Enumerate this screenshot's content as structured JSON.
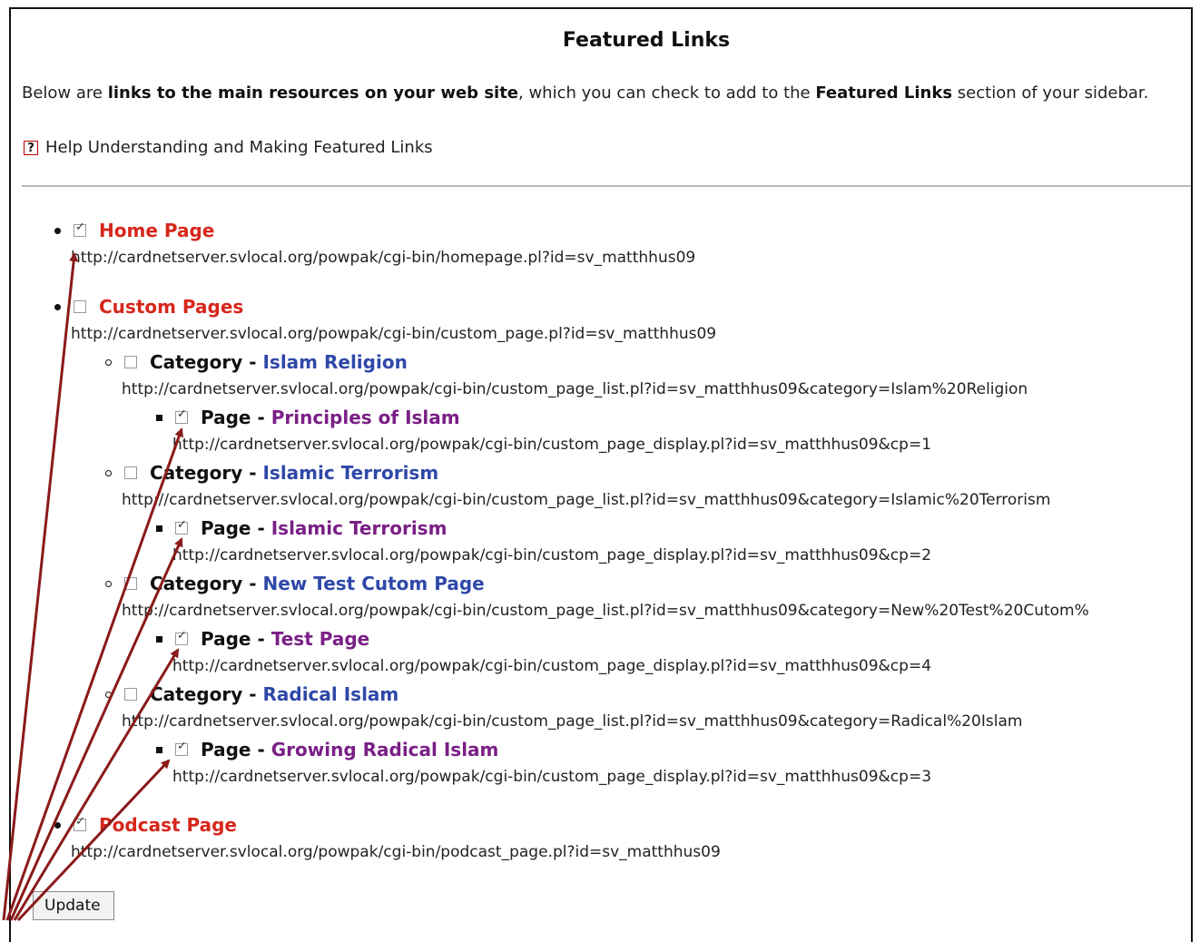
{
  "title": "Featured Links",
  "intro": {
    "part1": "Below are ",
    "bold1": "links to the main resources on your web site",
    "part2": ", which you can check to add to the ",
    "bold2": "Featured Links",
    "part3": " section of your sidebar."
  },
  "help": {
    "icon": "help-icon",
    "label": "Help Understanding and Making Featured Links"
  },
  "items": {
    "home": {
      "label": "Home Page",
      "url": "http://cardnetserver.svlocal.org/powpak/cgi-bin/homepage.pl?id=sv_matthhus09",
      "checked": true
    },
    "custom": {
      "label": "Custom Pages",
      "url": "http://cardnetserver.svlocal.org/powpak/cgi-bin/custom_page.pl?id=sv_matthhus09",
      "checked": false
    },
    "cat1": {
      "prefix": "Category - ",
      "name": "Islam Religion",
      "url": "http://cardnetserver.svlocal.org/powpak/cgi-bin/custom_page_list.pl?id=sv_matthhus09&category=Islam%20Religion",
      "checked": false
    },
    "page1": {
      "prefix": "Page - ",
      "name": "Principles of Islam",
      "url": "http://cardnetserver.svlocal.org/powpak/cgi-bin/custom_page_display.pl?id=sv_matthhus09&cp=1",
      "checked": true
    },
    "cat2": {
      "prefix": "Category - ",
      "name": "Islamic Terrorism",
      "url": "http://cardnetserver.svlocal.org/powpak/cgi-bin/custom_page_list.pl?id=sv_matthhus09&category=Islamic%20Terrorism",
      "checked": false
    },
    "page2": {
      "prefix": "Page - ",
      "name": "Islamic Terrorism",
      "url": "http://cardnetserver.svlocal.org/powpak/cgi-bin/custom_page_display.pl?id=sv_matthhus09&cp=2",
      "checked": true
    },
    "cat3": {
      "prefix": "Category - ",
      "name": "New Test Cutom Page",
      "url": "http://cardnetserver.svlocal.org/powpak/cgi-bin/custom_page_list.pl?id=sv_matthhus09&category=New%20Test%20Cutom%",
      "checked": false
    },
    "page3": {
      "prefix": "Page - ",
      "name": "Test Page",
      "url": "http://cardnetserver.svlocal.org/powpak/cgi-bin/custom_page_display.pl?id=sv_matthhus09&cp=4",
      "checked": true
    },
    "cat4": {
      "prefix": "Category - ",
      "name": "Radical Islam",
      "url": "http://cardnetserver.svlocal.org/powpak/cgi-bin/custom_page_list.pl?id=sv_matthhus09&category=Radical%20Islam",
      "checked": false
    },
    "page4": {
      "prefix": "Page - ",
      "name": "Growing Radical Islam",
      "url": "http://cardnetserver.svlocal.org/powpak/cgi-bin/custom_page_display.pl?id=sv_matthhus09&cp=3",
      "checked": true
    },
    "podcast": {
      "label": "Podcast Page",
      "url": "http://cardnetserver.svlocal.org/powpak/cgi-bin/podcast_page.pl?id=sv_matthhus09",
      "checked": true
    }
  },
  "update_button": "Update",
  "annotation_color": "#8b1a1a"
}
